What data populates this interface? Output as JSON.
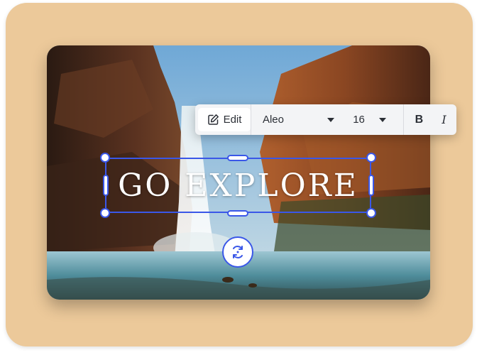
{
  "canvas": {
    "headline": "GO EXPLORE"
  },
  "toolbar": {
    "edit_label": "Edit",
    "font_family": "Aleo",
    "font_size": "16",
    "bold_label": "B",
    "italic_label": "I"
  },
  "icons": {
    "edit": "pencil-square-icon",
    "font_dropdown": "chevron-down-icon",
    "size_dropdown": "chevron-down-icon",
    "rotate": "rotate-icon"
  },
  "colors": {
    "accent": "#3a57e8",
    "backdrop": "#ecc99a",
    "toolbar_bg": "#f3f4f6",
    "text_dark": "#2b2f36"
  }
}
